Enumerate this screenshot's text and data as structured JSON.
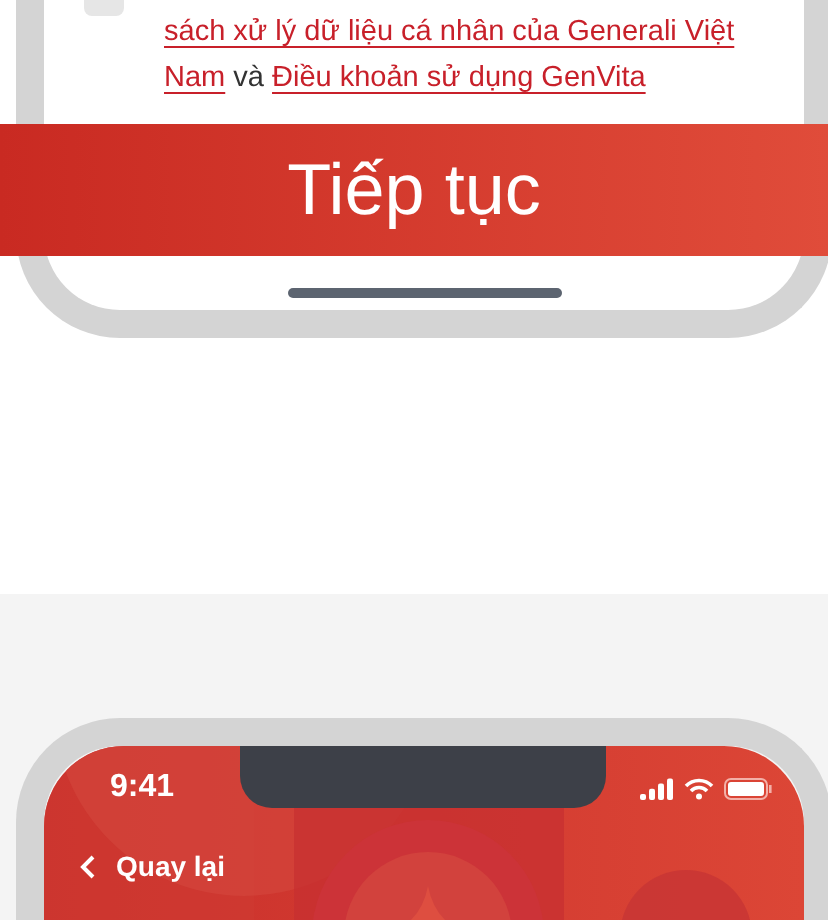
{
  "consent": {
    "checked": false,
    "lines": [
      [
        {
          "kind": "link",
          "text": "sách xử lý dữ liệu cá nhân của Generali Việt"
        }
      ],
      [
        {
          "kind": "link",
          "text": "Nam"
        },
        {
          "kind": "text",
          "text": "và"
        },
        {
          "kind": "link",
          "text": "Điều khoản sử dụng GenVita"
        }
      ]
    ]
  },
  "continue_button": {
    "label": "Tiếp tục"
  },
  "status_bar": {
    "time": "9:41"
  },
  "nav": {
    "back_label": "Quay lại"
  }
}
